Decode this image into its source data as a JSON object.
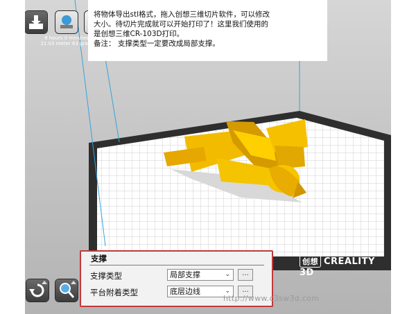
{
  "print_info": {
    "time": "8 hours 0 minutes",
    "material": "21.03 meter 63 gram"
  },
  "note": {
    "lines": [
      "将物体导出stl格式，拖入创想三维切片软件，可以修改",
      "大小。待切片完成就可以开始打印了！这里我们使用的",
      "是创想三维CR-103D打印。",
      "备注：  支撑类型一定要改成局部支撑。"
    ]
  },
  "support_panel": {
    "title": "支撑",
    "rows": [
      {
        "label": "支撑类型",
        "value": "局部支撑",
        "more": "..."
      },
      {
        "label": "平台附着类型",
        "value": "底层边线",
        "more": "..."
      }
    ]
  },
  "brand": {
    "mark": "创想",
    "text": "CREALITY 3D"
  },
  "watermark": "http://www.c3sw3d.com",
  "colors": {
    "model_yellow": "#f5c000",
    "highlight_box": "#c0393b",
    "bed_border": "#333333",
    "viewport_bg": "#c6c6c6"
  },
  "icons": {
    "top_toolbar": [
      "load-icon",
      "print-icon",
      "creality-icon"
    ],
    "bottom_toolbar": [
      "rotate-icon",
      "scale-icon",
      "mirror-icon"
    ]
  }
}
